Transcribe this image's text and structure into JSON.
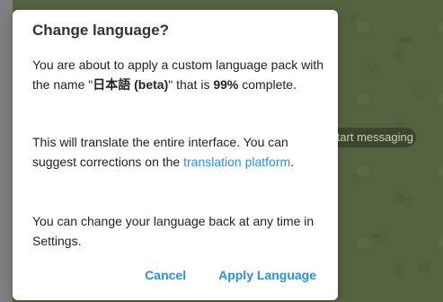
{
  "background": {
    "pill_text": "Start messaging"
  },
  "dialog": {
    "title": "Change language?",
    "p1": {
      "part1": "You are about to apply a custom language pack with the name \"",
      "pack_name": "日本語 (beta)",
      "part2": "\" that is ",
      "percent": "99%",
      "part3": " complete."
    },
    "p2": {
      "part1": "This will translate the entire interface. You can suggest corrections on the ",
      "link": "translation platform",
      "part2": "."
    },
    "p3": "You can change your language back at any time in Settings.",
    "buttons": {
      "cancel": "Cancel",
      "apply": "Apply Language"
    }
  },
  "colors": {
    "accent": "#2b90d9",
    "chat_background": "#55623f",
    "overlay": "#6f6f6f"
  }
}
